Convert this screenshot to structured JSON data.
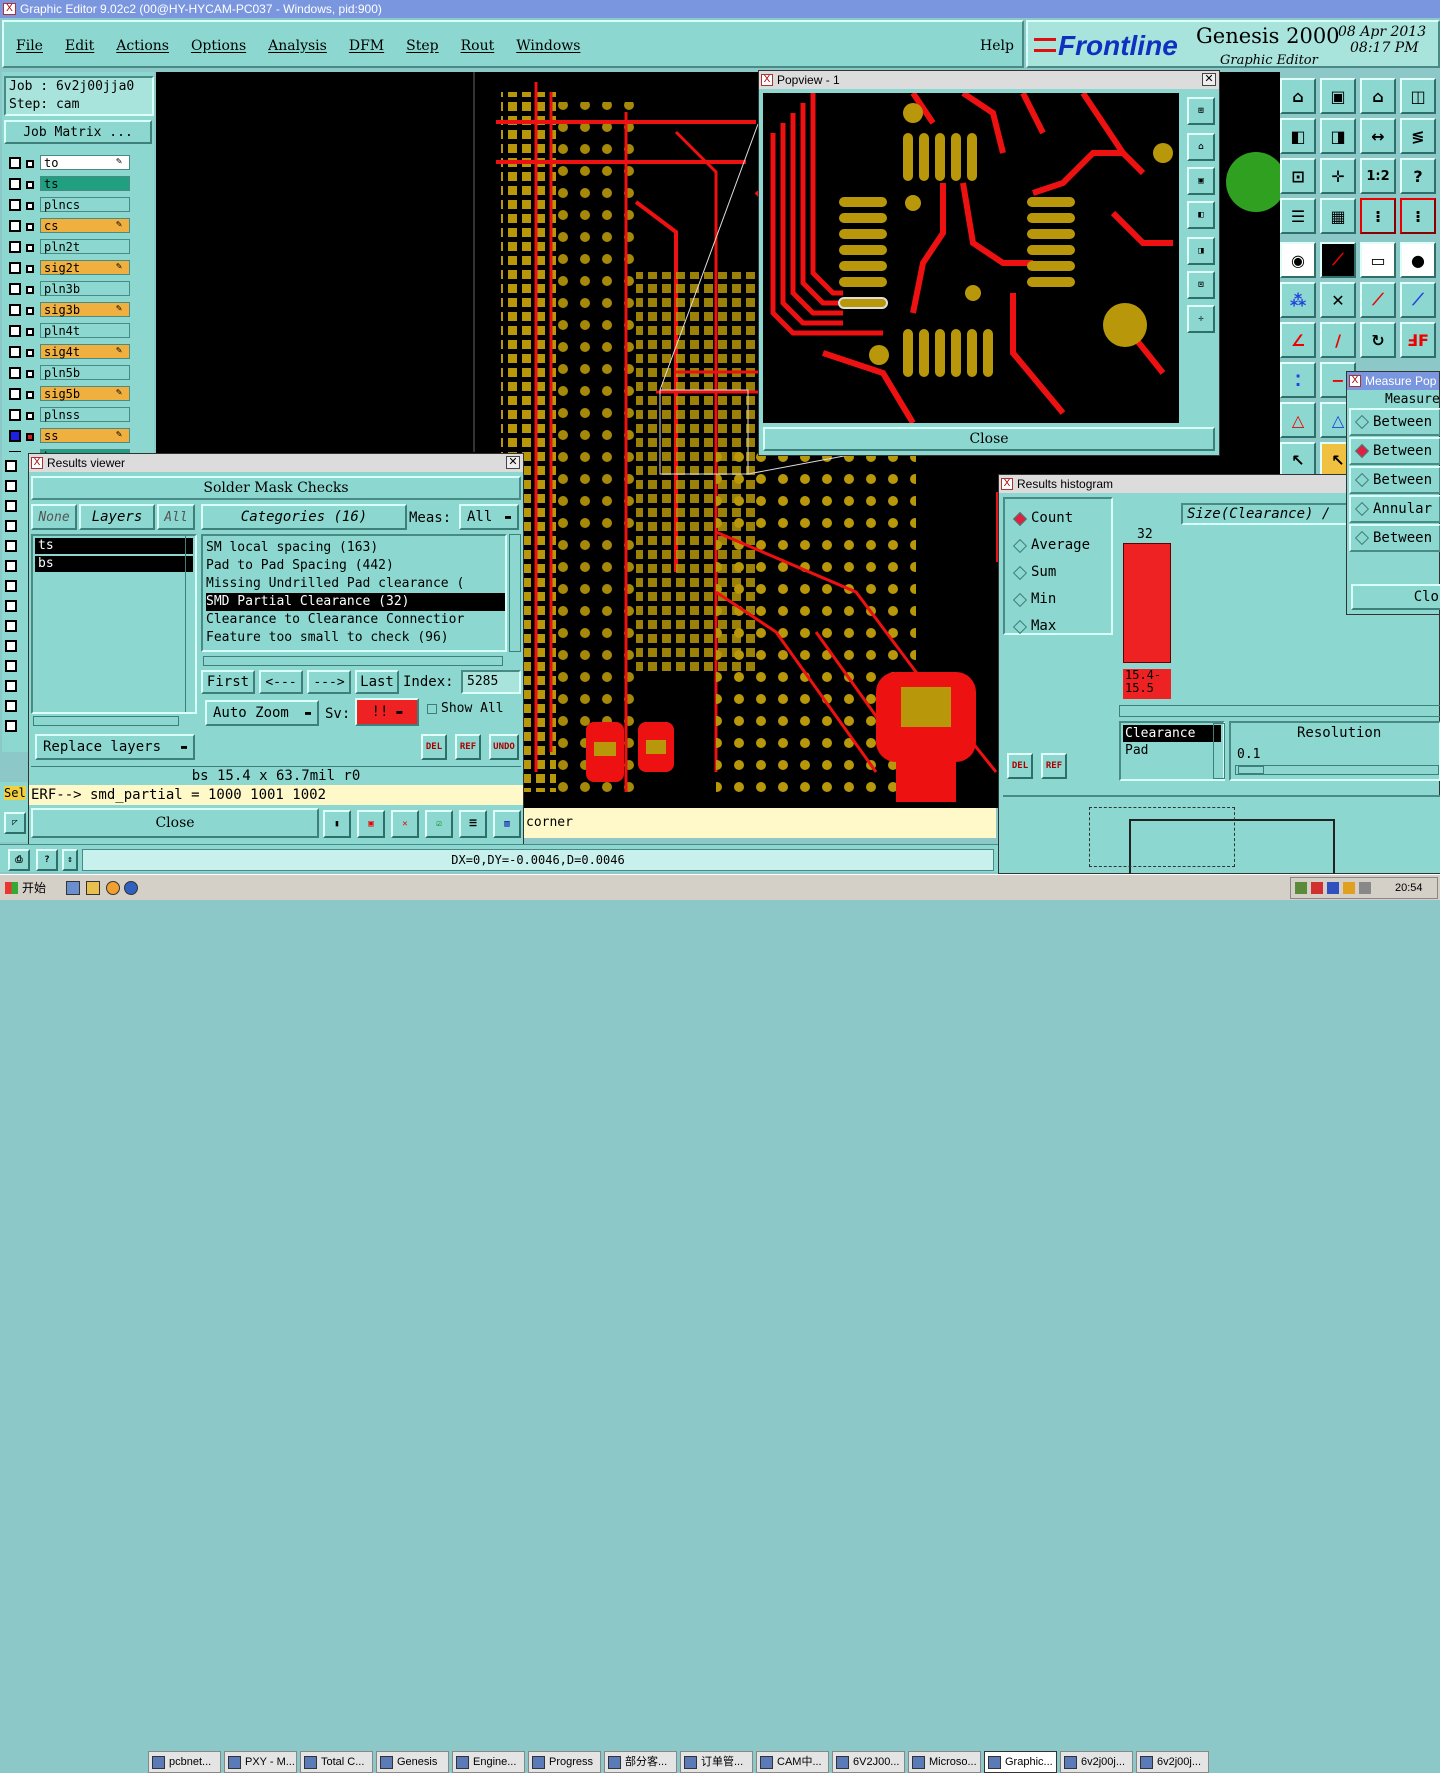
{
  "window": {
    "title": "Graphic Editor 9.02c2 (00@HY-HYCAM-PC037 - Windows, pid:900)"
  },
  "menu": [
    "File",
    "Edit",
    "Actions",
    "Options",
    "Analysis",
    "DFM",
    "Step",
    "Rout",
    "Windows"
  ],
  "help_label": "Help",
  "brand": {
    "logo": "Frontline",
    "product": "Genesis 2000",
    "subtitle": "Graphic Editor",
    "date": "08 Apr 2013",
    "time": "08:17 PM"
  },
  "job": {
    "job_line": "Job : 6v2j00jja0",
    "step_line": "Step: cam",
    "matrix_button": "Job Matrix ..."
  },
  "layers": [
    {
      "name": "to",
      "color": "#ffffff",
      "mark": true
    },
    {
      "name": "ts",
      "color": "#20a080",
      "mark": false
    },
    {
      "name": "plncs",
      "color": "#8cd8d0",
      "mark": false
    },
    {
      "name": "cs",
      "color": "#f0b040",
      "mark": true
    },
    {
      "name": "pln2t",
      "color": "#8cd8d0",
      "mark": false
    },
    {
      "name": "sig2t",
      "color": "#f0b040",
      "mark": true
    },
    {
      "name": "pln3b",
      "color": "#8cd8d0",
      "mark": false
    },
    {
      "name": "sig3b",
      "color": "#f0b040",
      "mark": true
    },
    {
      "name": "pln4t",
      "color": "#8cd8d0",
      "mark": false
    },
    {
      "name": "sig4t",
      "color": "#f0b040",
      "mark": true
    },
    {
      "name": "pln5b",
      "color": "#8cd8d0",
      "mark": false
    },
    {
      "name": "sig5b",
      "color": "#f0b040",
      "mark": true
    },
    {
      "name": "plnss",
      "color": "#8cd8d0",
      "mark": false
    },
    {
      "name": "ss",
      "color": "#f0b040",
      "mark": true
    },
    {
      "name": "bs",
      "color": "#20a080",
      "mark": false
    }
  ],
  "results_viewer": {
    "title": "Results viewer",
    "header": "Solder Mask Checks",
    "filters": [
      "None",
      "Layers",
      "All"
    ],
    "categories_label": "Categories (16)",
    "meas_label": "Meas:",
    "meas_value": "All",
    "layer_list": [
      "ts",
      "bs"
    ],
    "category_list": [
      "SM local spacing (163)",
      "Pad to Pad Spacing (442)",
      "Missing Undrilled Pad clearance (",
      "SMD Partial Clearance (32)",
      "Clearance to Clearance Connectior",
      "Feature too small to check (96)"
    ],
    "selected_category": "SMD Partial Clearance (32)",
    "nav": {
      "first": "First",
      "prev": "<---",
      "next": "--->",
      "last": "Last",
      "index_label": "Index:",
      "index_value": "5285"
    },
    "auto_zoom": "Auto Zoom",
    "sv_label": "Sv:",
    "sv_value": "!!",
    "show_all": "Show All",
    "replace_layers": "Replace layers",
    "icon_labels": {
      "del": "DEL",
      "ref": "REF",
      "undo": "UNDO"
    },
    "info_line": "bs 15.4 x 63.7mil  r0",
    "erf_line": "ERF--> smd_partial = 1000 1001 1002",
    "close": "Close"
  },
  "popview": {
    "title": "Popview - 1",
    "close": "Close"
  },
  "histogram": {
    "title": "Results histogram",
    "stats": [
      "Count",
      "Average",
      "Sum",
      "Min",
      "Max"
    ],
    "selected_stat": "Count",
    "size_field": "Size(Clearance)  /",
    "bar_count": "32",
    "bar_label_1": "15.4-",
    "bar_label_2": "15.5",
    "count": 32,
    "attr_list": [
      "Clearance",
      "Pad"
    ],
    "resolution_label": "Resolution",
    "resolution_value": "0.1",
    "icon_labels": {
      "del": "DEL",
      "ref": "REF"
    }
  },
  "measure": {
    "title": "Measure Pop",
    "header": "Measure",
    "items": [
      "Between",
      "Between",
      "Between",
      "Annular",
      "Between"
    ],
    "selected_index": 1,
    "close": "Clo"
  },
  "status": {
    "sel_label": "Sel",
    "hint": "corner",
    "coords": "DX=0,DY=-0.0046,D=0.0046"
  },
  "toolbar_icons": [
    "1:2",
    "?"
  ],
  "taskbar": {
    "start": "开始",
    "items": [
      "pcbnet...",
      "PXY - M...",
      "Total C...",
      "Genesis",
      "Engine...",
      "Progress",
      "部分客...",
      "订单管...",
      "CAM中...",
      "6V2J00...",
      "Microso...",
      "Graphic...",
      "6v2j00j...",
      "6v2j00j..."
    ],
    "active": "Graphic...",
    "clock": "20:54"
  },
  "colors": {
    "bg": "#8cc8c8",
    "panel": "#8cd8d0",
    "copper": "#b8980a",
    "trace": "#ee1111",
    "board": "#000000"
  }
}
